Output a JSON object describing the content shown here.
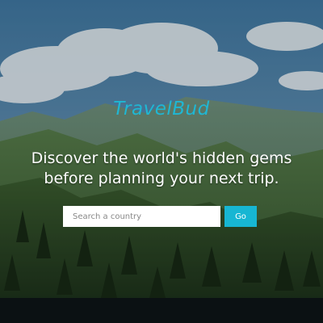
{
  "hero": {
    "background_image": "mountain-landscape-with-clouds",
    "brand_name": "TravelBud",
    "headline": "Discover the world's hidden gems before planning your next trip."
  },
  "search": {
    "placeholder": "Search a country",
    "value": "",
    "button_label": "Go"
  },
  "colors": {
    "accent": "#17b6d3",
    "footer": "#0b1113"
  }
}
